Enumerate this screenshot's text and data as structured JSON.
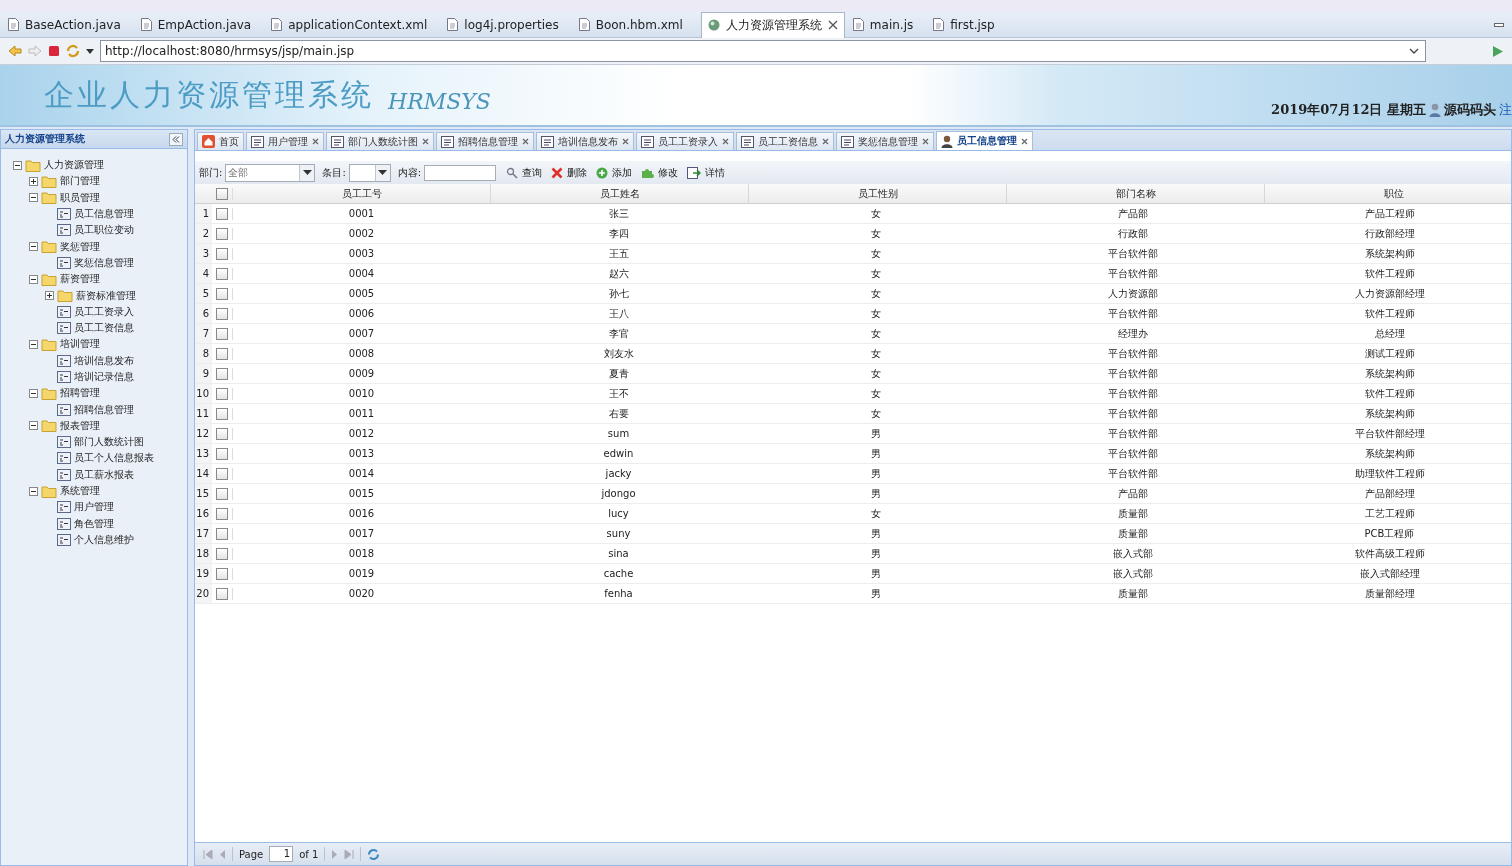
{
  "editor_tabs": [
    {
      "label": "BaseAction.java",
      "selected": false
    },
    {
      "label": "EmpAction.java",
      "selected": false
    },
    {
      "label": "applicationContext.xml",
      "selected": false
    },
    {
      "label": "log4j.properties",
      "selected": false
    },
    {
      "label": "Boon.hbm.xml",
      "selected": false
    },
    {
      "label": "人力资源管理系统",
      "selected": true
    },
    {
      "label": "main.js",
      "selected": false
    },
    {
      "label": "first.jsp",
      "selected": false
    }
  ],
  "address_bar": {
    "value": "http://localhost:8080/hrmsys/jsp/main.jsp"
  },
  "banner": {
    "title": "企业人力资源管理系统",
    "subtitle": "HRMSYS",
    "date": "2019年07月12日 星期五",
    "user": "源码码头",
    "link": "注"
  },
  "sidebar": {
    "title": "人力资源管理系统",
    "tree": [
      {
        "label": "人力资源管理",
        "kind": "folder",
        "expanded": true,
        "children": [
          {
            "label": "部门管理",
            "kind": "folder",
            "expanded": false
          },
          {
            "label": "职员管理",
            "kind": "folder",
            "expanded": true,
            "children": [
              {
                "label": "员工信息管理",
                "kind": "leaf"
              },
              {
                "label": "员工职位变动",
                "kind": "leaf"
              }
            ]
          },
          {
            "label": "奖惩管理",
            "kind": "folder",
            "expanded": true,
            "children": [
              {
                "label": "奖惩信息管理",
                "kind": "leaf"
              }
            ]
          },
          {
            "label": "薪资管理",
            "kind": "folder",
            "expanded": true,
            "children": [
              {
                "label": "薪资标准管理",
                "kind": "folder",
                "expanded": false
              },
              {
                "label": "员工工资录入",
                "kind": "leaf"
              },
              {
                "label": "员工工资信息",
                "kind": "leaf"
              }
            ]
          },
          {
            "label": "培训管理",
            "kind": "folder",
            "expanded": true,
            "children": [
              {
                "label": "培训信息发布",
                "kind": "leaf"
              },
              {
                "label": "培训记录信息",
                "kind": "leaf"
              }
            ]
          },
          {
            "label": "招聘管理",
            "kind": "folder",
            "expanded": true,
            "children": [
              {
                "label": "招聘信息管理",
                "kind": "leaf"
              }
            ]
          },
          {
            "label": "报表管理",
            "kind": "folder",
            "expanded": true,
            "children": [
              {
                "label": "部门人数统计图",
                "kind": "leaf"
              },
              {
                "label": "员工个人信息报表",
                "kind": "leaf"
              },
              {
                "label": "员工薪水报表",
                "kind": "leaf"
              }
            ]
          },
          {
            "label": "系统管理",
            "kind": "folder",
            "expanded": true,
            "children": [
              {
                "label": "用户管理",
                "kind": "leaf"
              },
              {
                "label": "角色管理",
                "kind": "leaf"
              },
              {
                "label": "个人信息维护",
                "kind": "leaf"
              }
            ]
          }
        ]
      }
    ]
  },
  "tabs": [
    {
      "label": "首页",
      "selected": false,
      "closable": false
    },
    {
      "label": "用户管理",
      "selected": false,
      "closable": true
    },
    {
      "label": "部门人数统计图",
      "selected": false,
      "closable": true
    },
    {
      "label": "招聘信息管理",
      "selected": false,
      "closable": true
    },
    {
      "label": "培训信息发布",
      "selected": false,
      "closable": true
    },
    {
      "label": "员工工资录入",
      "selected": false,
      "closable": true
    },
    {
      "label": "员工工资信息",
      "selected": false,
      "closable": true
    },
    {
      "label": "奖惩信息管理",
      "selected": false,
      "closable": true
    },
    {
      "label": "员工信息管理",
      "selected": true,
      "closable": true
    }
  ],
  "filters": {
    "department_label": "部门:",
    "department_value": "全部",
    "entries_label": "条目:",
    "content_label": "内容:"
  },
  "actions": [
    "查询",
    "删除",
    "添加",
    "修改",
    "详情"
  ],
  "table": {
    "select_all_checked": false,
    "columns": [
      "员工工号",
      "员工姓名",
      "员工性别",
      "部门名称",
      "职位"
    ],
    "rows": [
      {
        "number": "1",
        "checked": false,
        "cells": [
          "0001",
          "张三",
          "女",
          "产品部",
          "产品工程师"
        ]
      },
      {
        "number": "2",
        "checked": false,
        "cells": [
          "0002",
          "李四",
          "女",
          "行政部",
          "行政部经理"
        ]
      },
      {
        "number": "3",
        "checked": false,
        "cells": [
          "0003",
          "王五",
          "女",
          "平台软件部",
          "系统架构师"
        ]
      },
      {
        "number": "4",
        "checked": false,
        "cells": [
          "0004",
          "赵六",
          "女",
          "平台软件部",
          "软件工程师"
        ]
      },
      {
        "number": "5",
        "checked": false,
        "cells": [
          "0005",
          "孙七",
          "女",
          "人力资源部",
          "人力资源部经理"
        ]
      },
      {
        "number": "6",
        "checked": false,
        "cells": [
          "0006",
          "王八",
          "女",
          "平台软件部",
          "软件工程师"
        ]
      },
      {
        "number": "7",
        "checked": false,
        "cells": [
          "0007",
          "李官",
          "女",
          "经理办",
          "总经理"
        ]
      },
      {
        "number": "8",
        "checked": false,
        "cells": [
          "0008",
          "刘友水",
          "女",
          "平台软件部",
          "测试工程师"
        ]
      },
      {
        "number": "9",
        "checked": false,
        "cells": [
          "0009",
          "夏青",
          "女",
          "平台软件部",
          "系统架构师"
        ]
      },
      {
        "number": "10",
        "checked": false,
        "cells": [
          "0010",
          "王不",
          "女",
          "平台软件部",
          "软件工程师"
        ]
      },
      {
        "number": "11",
        "checked": false,
        "cells": [
          "0011",
          "右要",
          "女",
          "平台软件部",
          "系统架构师"
        ]
      },
      {
        "number": "12",
        "checked": false,
        "cells": [
          "0012",
          "sum",
          "男",
          "平台软件部",
          "平台软件部经理"
        ]
      },
      {
        "number": "13",
        "checked": false,
        "cells": [
          "0013",
          "edwin",
          "男",
          "平台软件部",
          "系统架构师"
        ]
      },
      {
        "number": "14",
        "checked": false,
        "cells": [
          "0014",
          "jacky",
          "男",
          "平台软件部",
          "助理软件工程师"
        ]
      },
      {
        "number": "15",
        "checked": false,
        "cells": [
          "0015",
          "jdongo",
          "男",
          "产品部",
          "产品部经理"
        ]
      },
      {
        "number": "16",
        "checked": false,
        "cells": [
          "0016",
          "lucy",
          "女",
          "质量部",
          "工艺工程师"
        ]
      },
      {
        "number": "17",
        "checked": false,
        "cells": [
          "0017",
          "suny",
          "男",
          "质量部",
          "PCB工程师"
        ]
      },
      {
        "number": "18",
        "checked": false,
        "cells": [
          "0018",
          "sina",
          "男",
          "嵌入式部",
          "软件高级工程师"
        ]
      },
      {
        "number": "19",
        "checked": false,
        "cells": [
          "0019",
          "cache",
          "男",
          "嵌入式部",
          "嵌入式部经理"
        ]
      },
      {
        "number": "20",
        "checked": false,
        "cells": [
          "0020",
          "fenha",
          "男",
          "质量部",
          "质量部经理"
        ]
      }
    ]
  },
  "pagination": {
    "page_label": "Page",
    "page": "1",
    "of": "of 1"
  }
}
